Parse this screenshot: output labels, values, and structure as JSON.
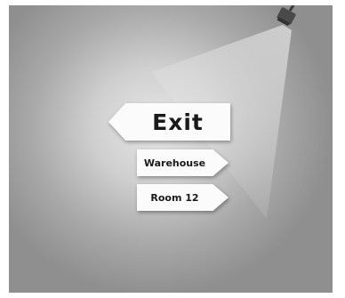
{
  "signs": {
    "exit": {
      "label": "Exit",
      "direction": "left"
    },
    "warehouse": {
      "label": "Warehouse",
      "direction": "right"
    },
    "room": {
      "label": "Room 12",
      "direction": "right"
    }
  },
  "colors": {
    "background_center": "#e6e6e6",
    "background_edge": "#8f8f8f",
    "sign_fill": "#fbfbfb",
    "sign_text": "#1a1a1a",
    "lamp": "#4a4a4a"
  },
  "icons": {
    "lamp": "spotlight-icon"
  }
}
